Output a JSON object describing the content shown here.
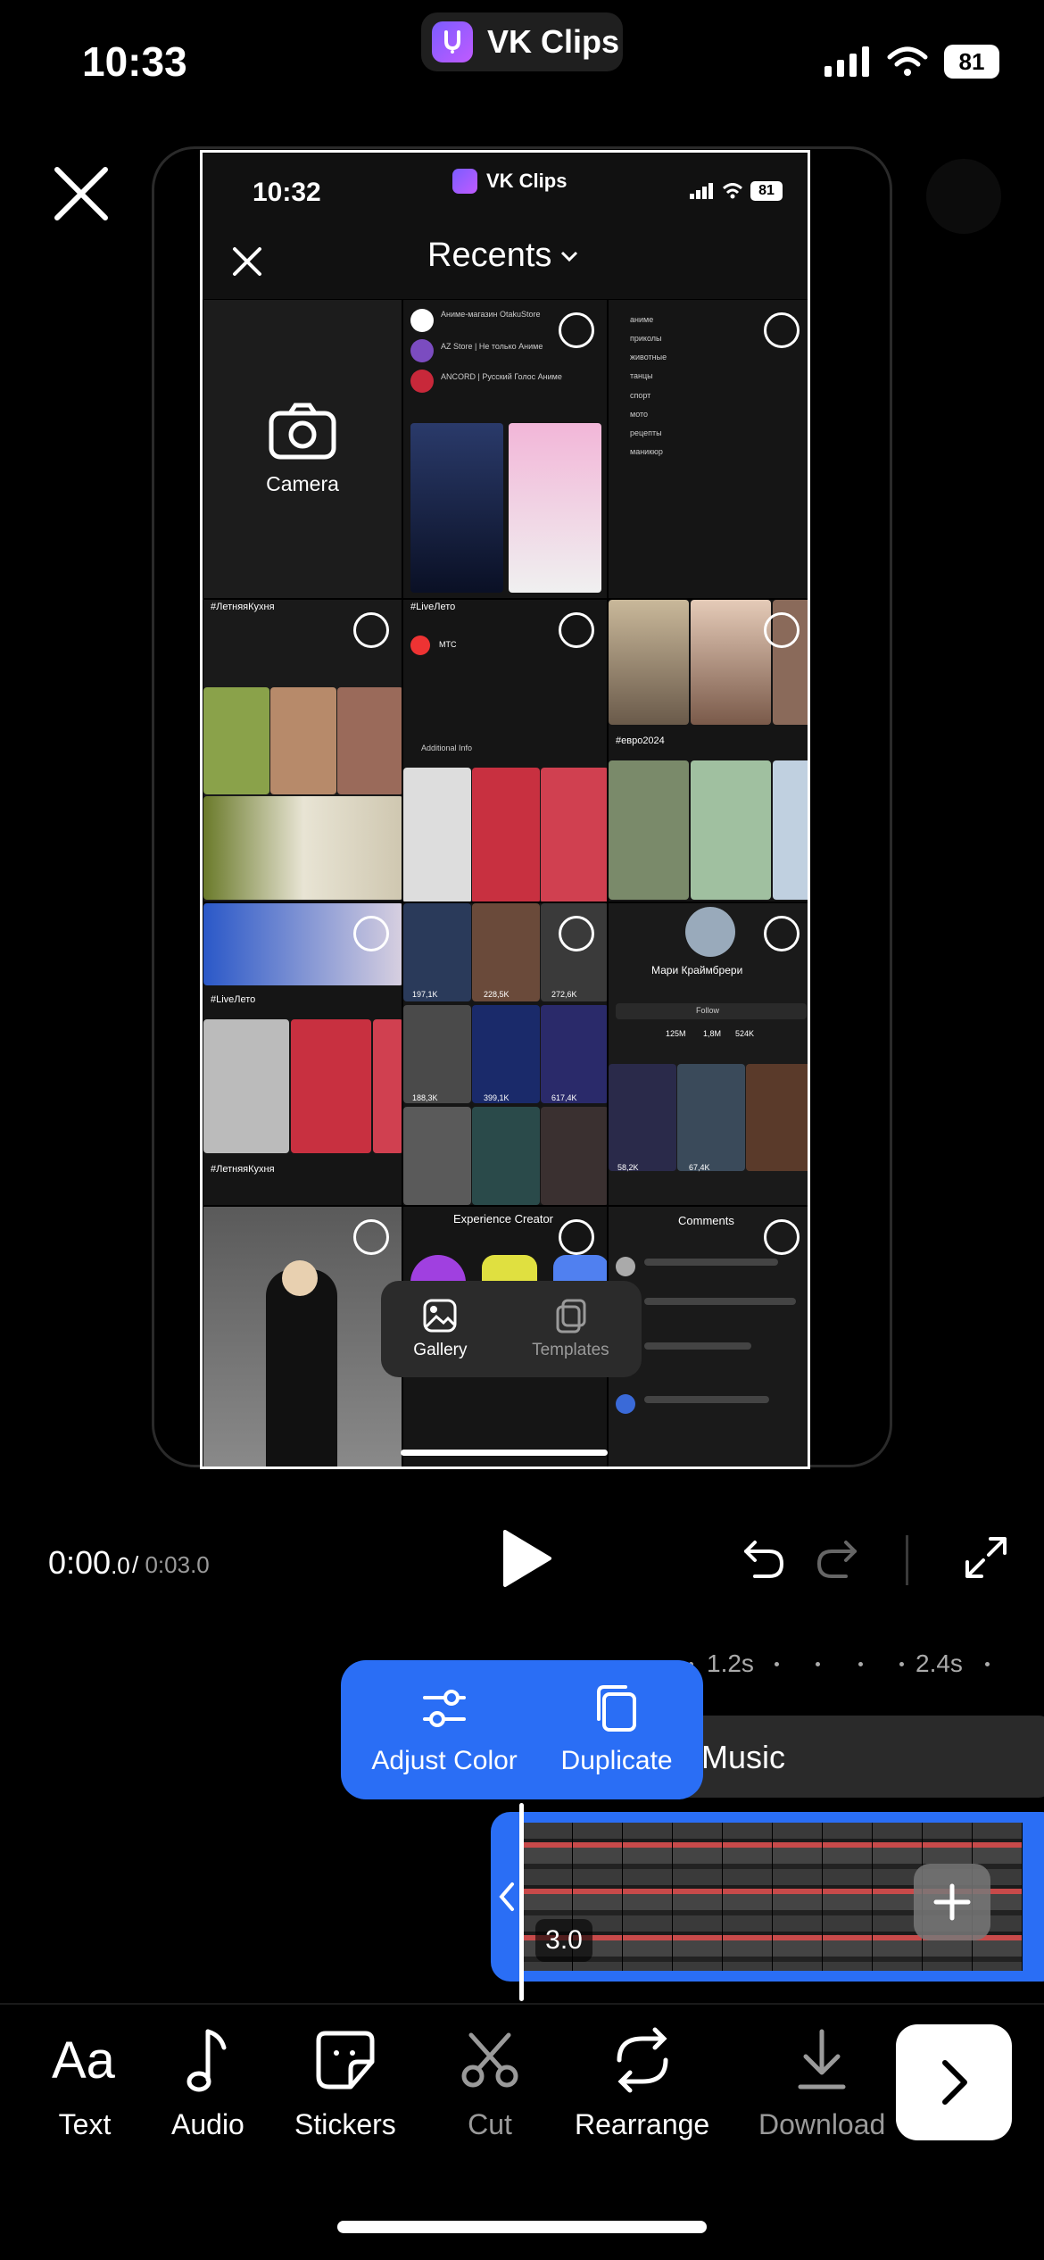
{
  "status_bar": {
    "time": "10:33",
    "app_name": "VK Clips",
    "battery": "81"
  },
  "preview": {
    "time": "10:32",
    "app_name": "VK Clips",
    "battery": "81",
    "title": "Recents",
    "camera_label": "Camera",
    "popup": {
      "gallery": "Gallery",
      "templates": "Templates"
    },
    "snippets": {
      "search_items": [
        "аниме",
        "приколы",
        "животные",
        "танцы",
        "спорт",
        "мото",
        "рецепты",
        "маникюр"
      ],
      "channels": [
        "Аниме-магазин OtakuStore",
        "AZ Store | Не только Аниме",
        "ANCORD | Русский Голос Аниме"
      ],
      "tags": [
        "#ЛетняяКухня",
        "#LiveЛето",
        "#евро2024",
        "#ЛетняяКухня"
      ],
      "profile_name": "Мари Краймбрери",
      "stats": [
        "125M",
        "1,8M",
        "524K"
      ],
      "experience_title": "Experience Creator",
      "comments_title": "Comments",
      "mts_title": "МТС",
      "additional_info": "Additional Info",
      "follow": "Follow",
      "view_counts": [
        "197,1K",
        "228,5K",
        "272,6K",
        "188,3K",
        "399,1K",
        "617,4K",
        "58,2K",
        "67,4K"
      ]
    }
  },
  "playback": {
    "current_main": "0:00",
    "current_frac": ".0",
    "separator": "/",
    "total_main": "0:03",
    "total_frac": ".0"
  },
  "timeline": {
    "ruler_labels": [
      "1.2s",
      "2.4s"
    ],
    "music_label": "Music",
    "clip_duration": "3.0",
    "context_menu": {
      "adjust_color": "Adjust Color",
      "duplicate": "Duplicate"
    }
  },
  "toolbar": {
    "text": "Text",
    "audio": "Audio",
    "stickers": "Stickers",
    "cut": "Cut",
    "rearrange": "Rearrange",
    "download": "Download"
  },
  "colors": {
    "accent": "#2a6ef5",
    "background": "#000000",
    "panel": "#2a2a2a"
  }
}
